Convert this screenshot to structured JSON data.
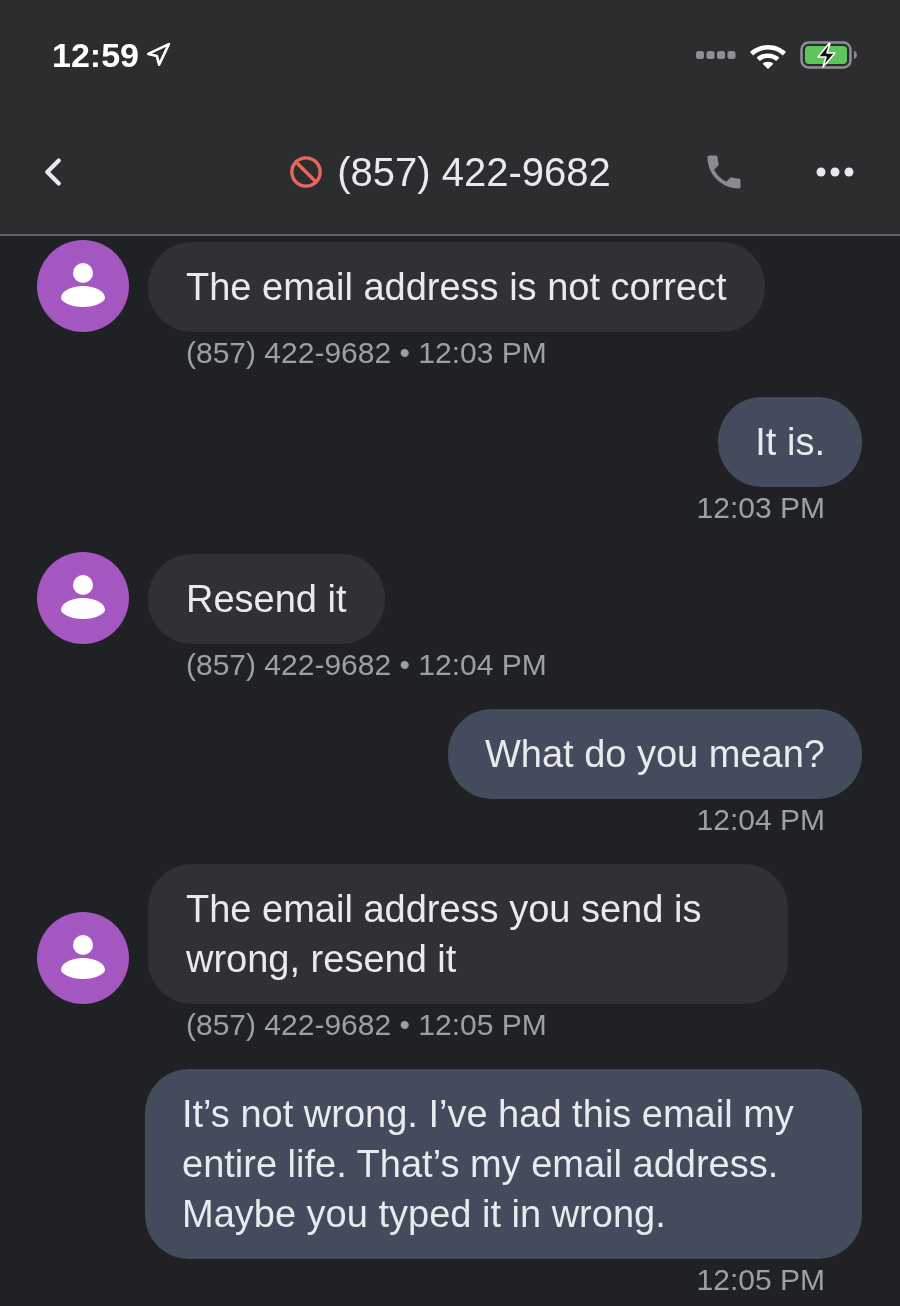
{
  "status_bar": {
    "time": "12:59"
  },
  "header": {
    "title": "(857) 422-9682"
  },
  "messages": [
    {
      "kind": "incoming",
      "text": "The email address is not correct",
      "meta": "(857) 422-9682 • 12:03 PM"
    },
    {
      "kind": "outgoing",
      "text": "It is.",
      "meta": "12:03 PM"
    },
    {
      "kind": "incoming",
      "text": "Resend it",
      "meta": "(857) 422-9682 • 12:04 PM"
    },
    {
      "kind": "outgoing",
      "text": "What do you mean?",
      "meta": "12:04 PM"
    },
    {
      "kind": "incoming",
      "text": "The email address you send is wrong, resend it",
      "meta": "(857) 422-9682 • 12:05 PM"
    },
    {
      "kind": "outgoing",
      "text": "It’s not wrong. I’ve had this email my entire life. That’s my email address. Maybe you typed it in wrong.",
      "meta": "12:05 PM"
    }
  ]
}
